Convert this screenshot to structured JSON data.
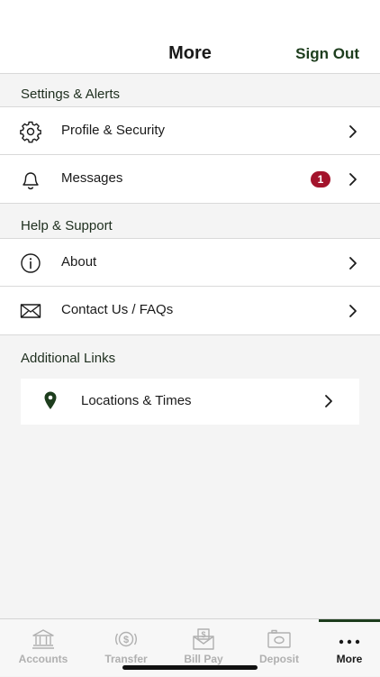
{
  "header": {
    "title": "More",
    "sign_out": "Sign Out"
  },
  "sections": {
    "settings": {
      "label": "Settings & Alerts",
      "items": [
        {
          "label": "Profile & Security",
          "icon": "gear-icon"
        },
        {
          "label": "Messages",
          "icon": "bell-icon",
          "badge": "1"
        }
      ]
    },
    "help": {
      "label": "Help & Support",
      "items": [
        {
          "label": "About",
          "icon": "info-icon"
        },
        {
          "label": "Contact Us / FAQs",
          "icon": "envelope-icon"
        }
      ]
    },
    "links": {
      "label": "Additional Links",
      "items": [
        {
          "label": "Locations & Times",
          "icon": "location-pin-icon"
        }
      ]
    }
  },
  "tabbar": {
    "tabs": [
      {
        "label": "Accounts",
        "icon": "bank-icon"
      },
      {
        "label": "Transfer",
        "icon": "transfer-icon"
      },
      {
        "label": "Bill Pay",
        "icon": "bill-pay-icon"
      },
      {
        "label": "Deposit",
        "icon": "camera-icon"
      },
      {
        "label": "More",
        "icon": "more-dots-icon",
        "active": true
      }
    ]
  },
  "colors": {
    "accent": "#1d3d1d",
    "badge": "#a3142c",
    "background": "#f4f4f4",
    "inactive_tab": "#b0b0b0"
  }
}
